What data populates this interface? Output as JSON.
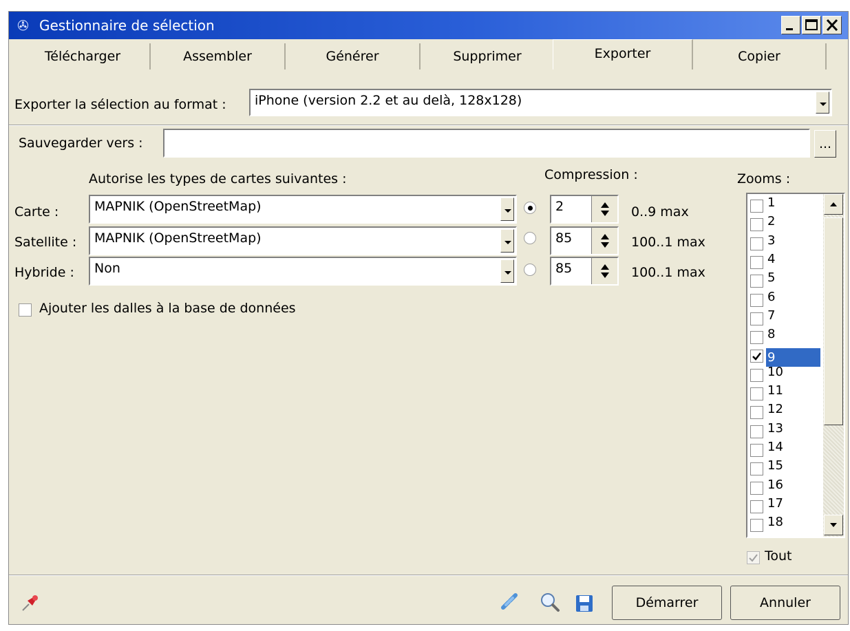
{
  "window": {
    "title": "Gestionnaire de sélection"
  },
  "tabs": [
    {
      "label": "Télécharger"
    },
    {
      "label": "Assembler"
    },
    {
      "label": "Générer"
    },
    {
      "label": "Supprimer"
    },
    {
      "label": "Exporter",
      "active": true
    },
    {
      "label": "Copier"
    }
  ],
  "export": {
    "format_label": "Exporter la sélection au format :",
    "format_value": "iPhone (version 2.2 et au delà, 128x128)",
    "save_label": "Sauvegarder vers :",
    "save_value": "",
    "browse_label": "..."
  },
  "maps": {
    "header": "Autorise les types de cartes suivantes :",
    "compression_header": "Compression :",
    "rows": [
      {
        "label": "Carte :",
        "value": "MAPNIK (OpenStreetMap)",
        "radio_selected": true,
        "compression": "2",
        "range": "0..9 max"
      },
      {
        "label": "Satellite :",
        "value": "MAPNIK (OpenStreetMap)",
        "radio_selected": false,
        "compression": "85",
        "range": "100..1 max"
      },
      {
        "label": "Hybride :",
        "value": "Non",
        "radio_selected": false,
        "compression": "85",
        "range": "100..1 max"
      }
    ],
    "add_db_label": "Ajouter les dalles à la base de données",
    "add_db_checked": false
  },
  "zooms": {
    "header": "Zooms :",
    "items": [
      "1",
      "2",
      "3",
      "4",
      "5",
      "6",
      "7",
      "8",
      "9",
      "10",
      "11",
      "12",
      "13",
      "14",
      "15",
      "16",
      "17",
      "18"
    ],
    "checked": [
      "9"
    ],
    "selected": "9",
    "all_label": "Tout",
    "all_checked": true
  },
  "footer": {
    "start_label": "Démarrer",
    "cancel_label": "Annuler",
    "icons": [
      "pin-icon",
      "link-icon",
      "zoom-icon",
      "save-icon"
    ]
  },
  "colors": {
    "titlebar": "#0a3bb8",
    "selection": "#316ac5",
    "face": "#ece9d8"
  }
}
